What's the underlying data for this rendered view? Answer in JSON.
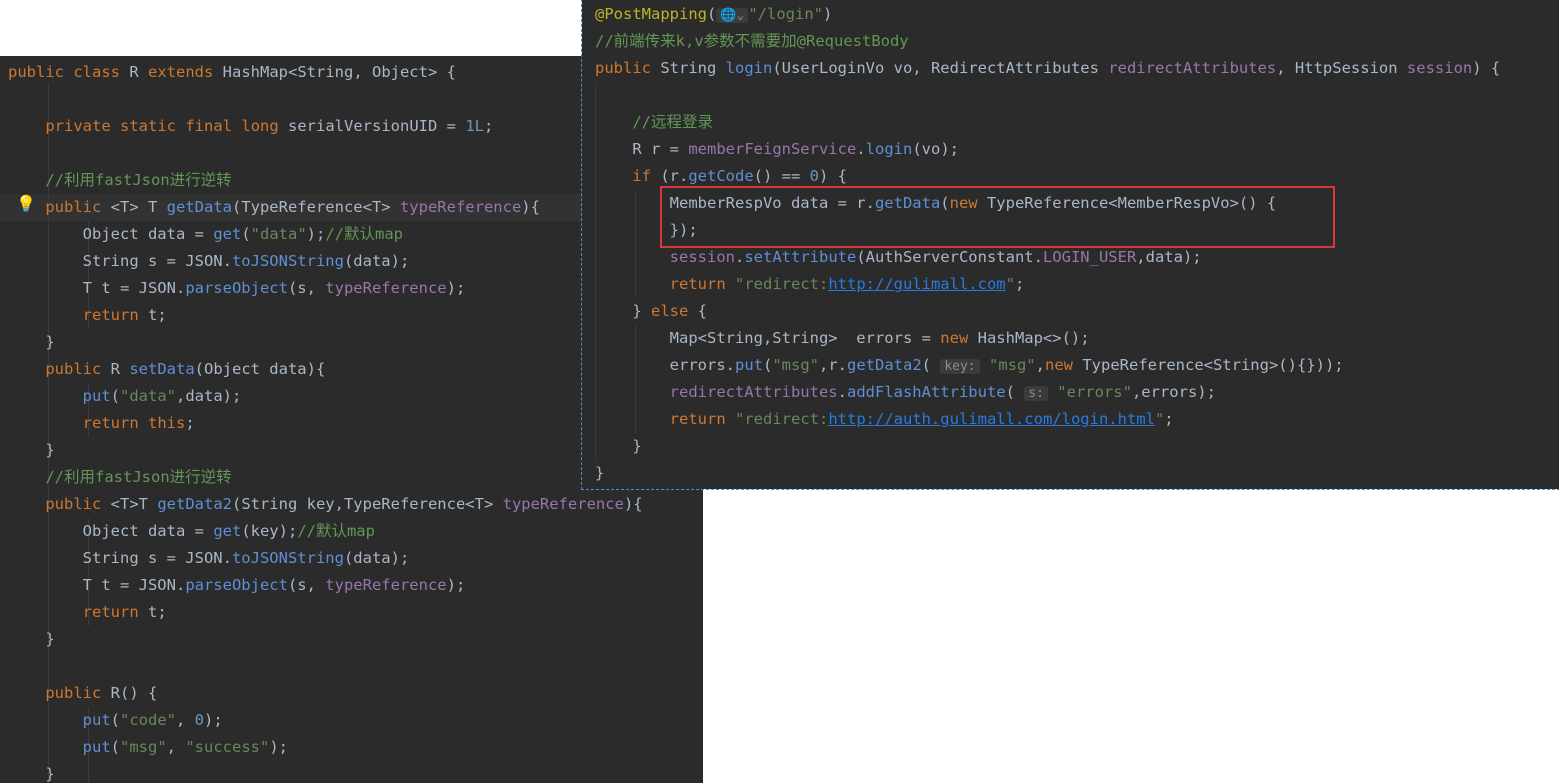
{
  "left_code": {
    "lines": [
      "public class R extends HashMap<String, Object> {",
      "",
      "    private static final long serialVersionUID = 1L;",
      "",
      "    //利用fastJson进行逆转",
      "    public <T> T getData(TypeReference<T> typeReference){",
      "        Object data = get(\"data\");//默认map",
      "        String s = JSON.toJSONString(data);",
      "        T t = JSON.parseObject(s, typeReference);",
      "        return t;",
      "    }",
      "    public R setData(Object data){",
      "        put(\"data\",data);",
      "        return this;",
      "    }",
      "    //利用fastJson进行逆转",
      "    public <T>T getData2(String key,TypeReference<T> typeReference){",
      "        Object data = get(key);//默认map",
      "        String s = JSON.toJSONString(data);",
      "        T t = JSON.parseObject(s, typeReference);",
      "        return t;",
      "    }",
      "",
      "    public R() {",
      "        put(\"code\", 0);",
      "        put(\"msg\", \"success\");",
      "    }"
    ]
  },
  "right_code": {
    "lines": [
      "@PostMapping(\"/login\")",
      "//前端传来k,v参数不需要加@RequestBody",
      "public String login(UserLoginVo vo, RedirectAttributes redirectAttributes, HttpSession session) {",
      "",
      "    //远程登录",
      "    R r = memberFeignService.login(vo);",
      "    if (r.getCode() == 0) {",
      "        MemberRespVo data = r.getData(new TypeReference<MemberRespVo>() {",
      "        });",
      "        session.setAttribute(AuthServerConstant.LOGIN_USER,data);",
      "        return \"redirect:http://gulimall.com\";",
      "    } else {",
      "        Map<String,String>  errors = new HashMap<>();",
      "        errors.put(\"msg\",r.getData2( key: \"msg\",new TypeReference<String>(){}));",
      "        redirectAttributes.addFlashAttribute( s: \"errors\",errors);",
      "        return \"redirect:http://auth.gulimall.com/login.html\";",
      "    }",
      "}"
    ],
    "hints": {
      "key": "key:",
      "s": "s:"
    },
    "icon": "globe-icon"
  },
  "colors": {
    "background": "#2b2b2b",
    "keyword": "#cc7832",
    "string": "#6a8759",
    "comment": "#629755",
    "highlight_box": "#d9383a"
  }
}
